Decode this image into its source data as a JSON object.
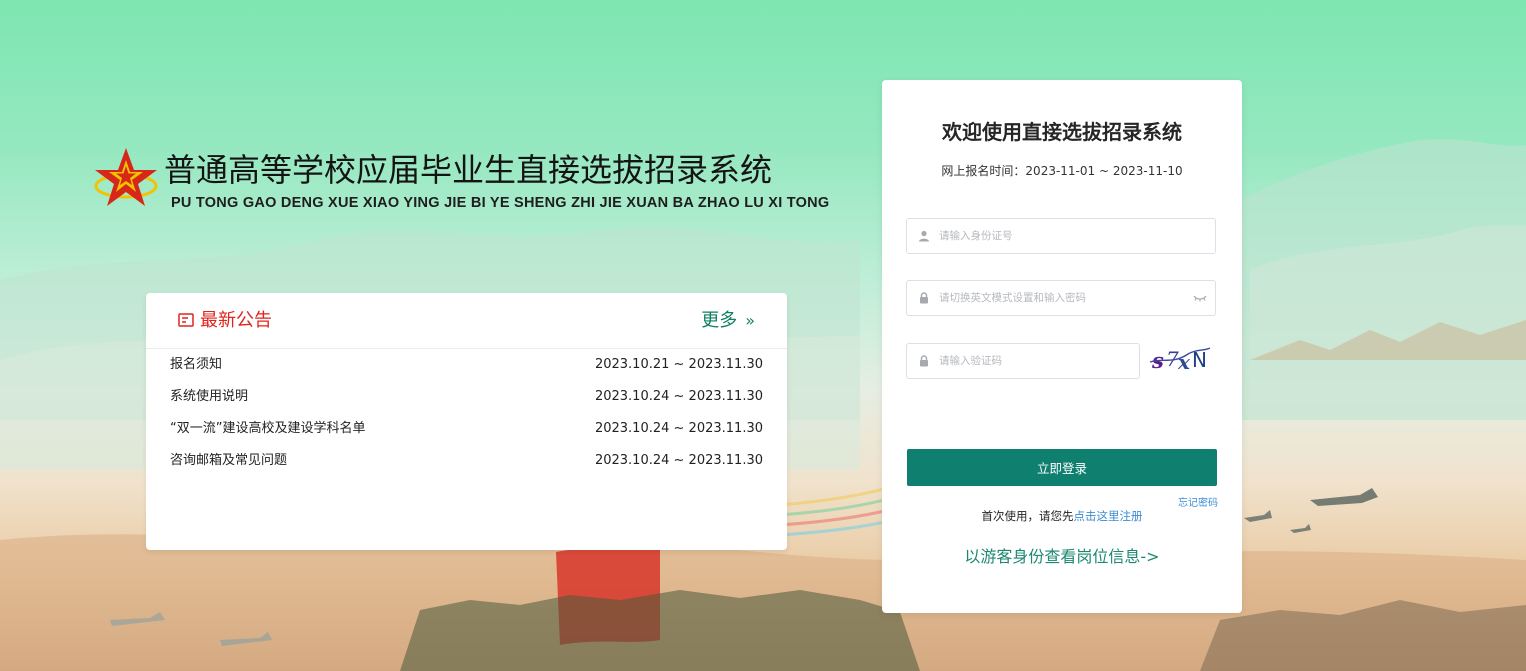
{
  "brand": {
    "title": "普通高等学校应届毕业生直接选拔招录系统",
    "subtitle": "PU TONG GAO DENG XUE XIAO YING JIE BI YE SHENG ZHI JIE XUAN BA ZHAO LU XI TONG",
    "logo_icon": "star-emblem-icon"
  },
  "notice": {
    "title": "最新公告",
    "more_label": "更多",
    "more_chevron": "»",
    "items": [
      {
        "title": "报名须知",
        "date": "2023.10.21 ~ 2023.11.30"
      },
      {
        "title": "系统使用说明",
        "date": "2023.10.24 ~ 2023.11.30"
      },
      {
        "title": "“双一流”建设高校及建设学科名单",
        "date": "2023.10.24 ~ 2023.11.30"
      },
      {
        "title": "咨询邮箱及常见问题",
        "date": "2023.10.24 ~ 2023.11.30"
      }
    ]
  },
  "login": {
    "title": "欢迎使用直接选拔招录系统",
    "time_label": "网上报名时间：",
    "time_range": "2023-11-01 ~ 2023-11-10",
    "id_placeholder": "请输入身份证号",
    "password_placeholder": "请切换英文模式设置和输入密码",
    "captcha_placeholder": "请输入验证码",
    "captcha_text": "s7xN",
    "submit_label": "立即登录",
    "forgot_label": "忘记密码",
    "register_prefix": "首次使用，请您先",
    "register_link": "点击这里注册",
    "guest_label": "以游客身份查看岗位信息->"
  },
  "colors": {
    "accent": "#0f7f70",
    "notice_red": "#e0231c",
    "link_blue": "#3d8cd6",
    "guest_green": "#1b8872"
  }
}
